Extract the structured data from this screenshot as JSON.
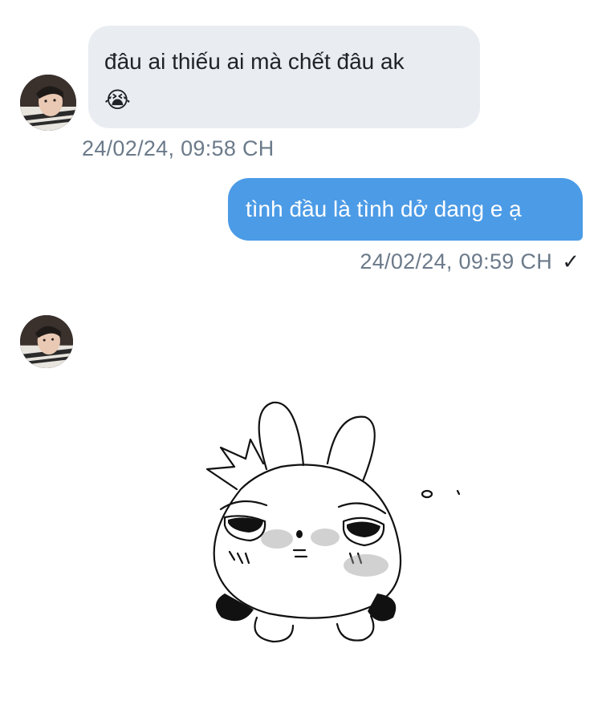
{
  "messages": [
    {
      "direction": "incoming",
      "text": "đâu ai thiếu ai mà chết đâu ak",
      "emoji": "😭",
      "timestamp": "24/02/24, 09:58 CH"
    },
    {
      "direction": "outgoing",
      "text": "tình đầu là tình dở dang e ạ",
      "timestamp": "24/02/24, 09:59 CH",
      "status_icon": "✓"
    },
    {
      "direction": "incoming",
      "type": "sticker",
      "sticker_name": "crying-bunny-sticker"
    }
  ],
  "colors": {
    "incoming_bubble": "#e9edf1",
    "outgoing_bubble": "#4c9be6",
    "timestamp": "#6b7a8a",
    "background": "#ffffff"
  }
}
